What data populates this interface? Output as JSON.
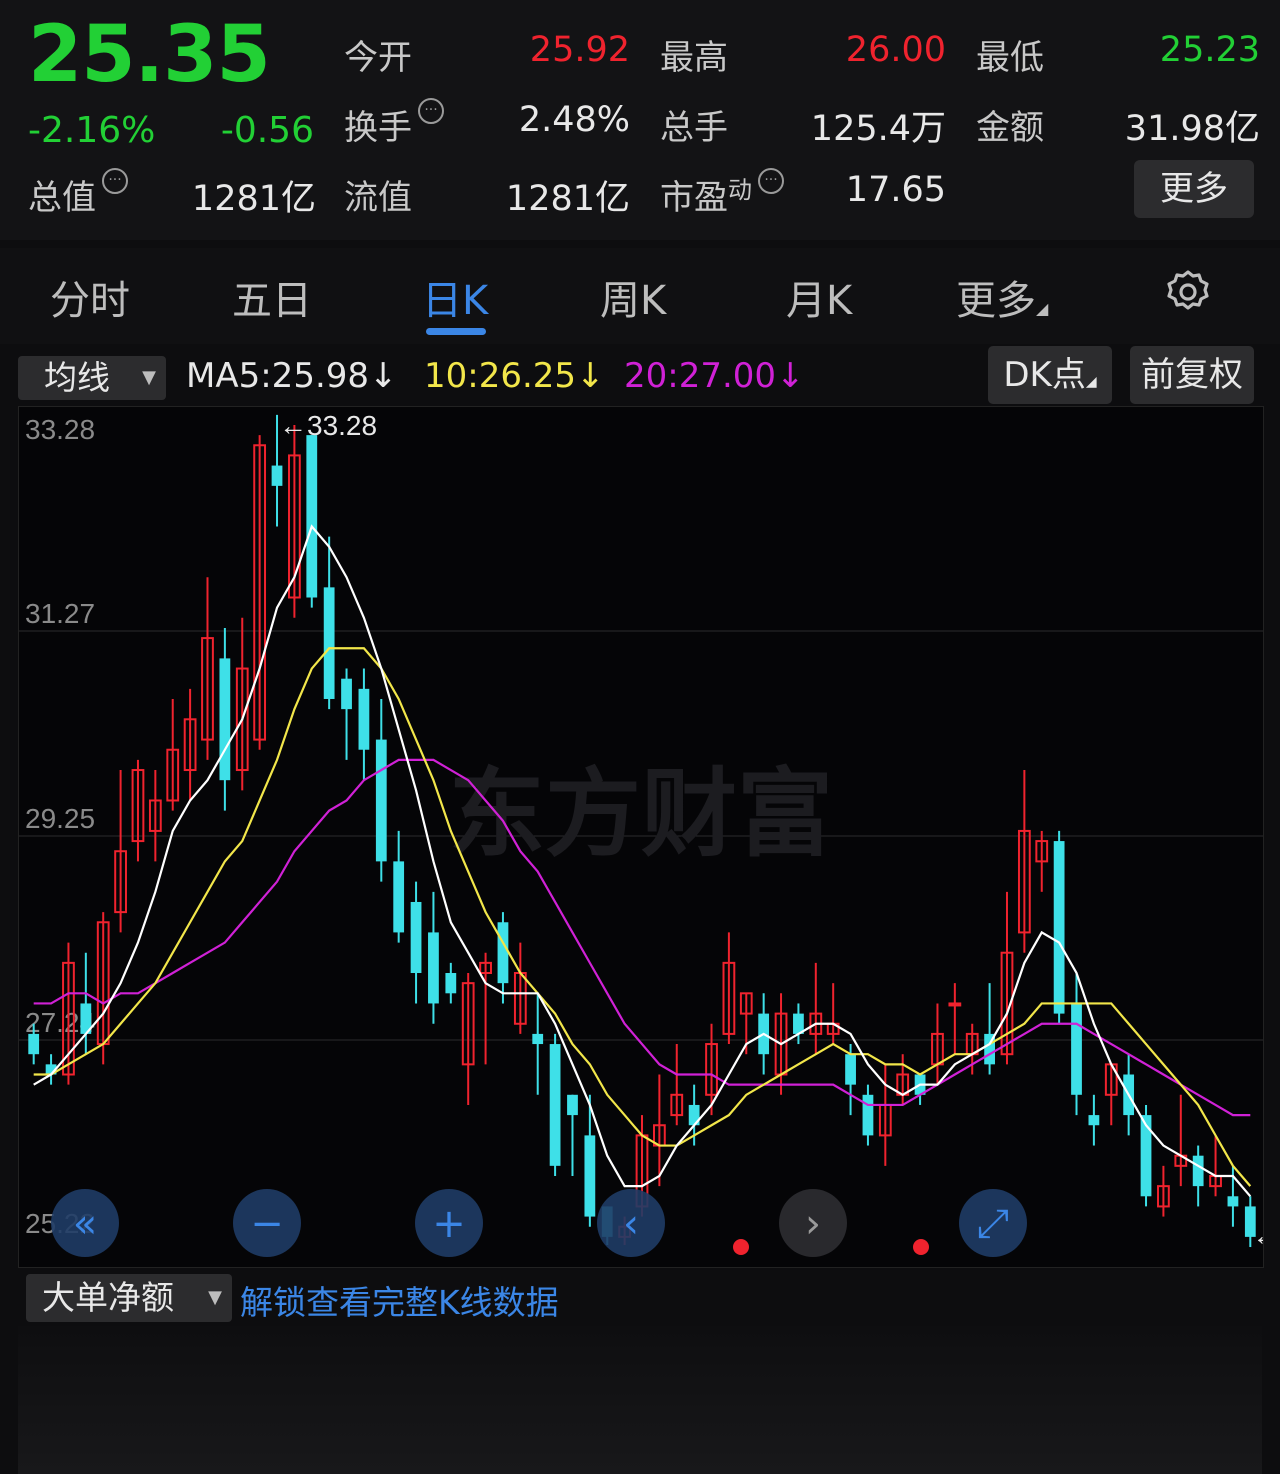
{
  "quote": {
    "price": "25.35",
    "change_pct": "-2.16%",
    "change": "-0.56",
    "fields": [
      {
        "label": "今开",
        "value": "25.92",
        "color": "red"
      },
      {
        "label": "最高",
        "value": "26.00",
        "color": "red"
      },
      {
        "label": "最低",
        "value": "25.23",
        "color": "green"
      },
      {
        "label": "换手",
        "value": "2.48%",
        "color": "white"
      },
      {
        "label": "总手",
        "value": "125.4万",
        "color": "white"
      },
      {
        "label": "金额",
        "value": "31.98亿",
        "color": "white"
      },
      {
        "label": "总值",
        "value": "1281亿",
        "color": "white"
      },
      {
        "label": "流值",
        "value": "1281亿",
        "color": "white"
      },
      {
        "label": "市盈",
        "label_sup": "动",
        "value": "17.65",
        "color": "white"
      }
    ],
    "more_label": "更多"
  },
  "tabs": [
    "分时",
    "五日",
    "日K",
    "周K",
    "月K",
    "更多"
  ],
  "active_tab": 2,
  "ma_bar": {
    "selector": "均线",
    "ma5": "MA5:25.98",
    "ma10": "10:26.25",
    "ma20": "20:27.00",
    "arrow": "↓",
    "dk_label": "DK点",
    "adjust_label": "前复权"
  },
  "bottom": {
    "selector": "大单净额",
    "unlock": "解锁查看完整K线数据"
  },
  "watermark": "东方财富",
  "colors": {
    "up": "#f0232e",
    "down": "#3ee0e8",
    "ma5": "#ffffff",
    "ma10": "#f2e64a",
    "ma20": "#d021d6",
    "accent": "#3b86e6",
    "price_green": "#22d035"
  },
  "chart_data": {
    "type": "candlestick",
    "y_ticks": [
      "33.28",
      "31.27",
      "29.25",
      "27.24",
      "25.22"
    ],
    "ylim": [
      25.22,
      33.28
    ],
    "max_label": "33.28",
    "min_label": "25.22",
    "candles": [
      [
        27.3,
        27.1,
        27.4,
        27.0
      ],
      [
        27.0,
        26.9,
        27.1,
        26.8
      ],
      [
        26.9,
        28.0,
        28.2,
        26.8
      ],
      [
        27.6,
        27.3,
        28.1,
        27.1
      ],
      [
        27.2,
        28.4,
        28.5,
        27.0
      ],
      [
        28.5,
        29.1,
        29.9,
        28.3
      ],
      [
        29.2,
        29.9,
        30.0,
        29.0
      ],
      [
        29.3,
        29.6,
        29.9,
        29.0
      ],
      [
        29.6,
        30.1,
        30.6,
        29.5
      ],
      [
        29.9,
        30.4,
        30.7,
        29.6
      ],
      [
        30.2,
        31.2,
        31.8,
        30.0
      ],
      [
        31.0,
        29.8,
        31.3,
        29.5
      ],
      [
        29.9,
        30.9,
        31.4,
        29.7
      ],
      [
        30.2,
        33.1,
        33.2,
        30.1
      ],
      [
        32.9,
        32.7,
        33.4,
        32.3
      ],
      [
        31.6,
        33.0,
        33.3,
        31.4
      ],
      [
        33.2,
        31.6,
        33.2,
        31.5
      ],
      [
        31.7,
        30.6,
        32.2,
        30.5
      ],
      [
        30.8,
        30.5,
        30.9,
        30.0
      ],
      [
        30.7,
        30.1,
        30.9,
        29.8
      ],
      [
        30.2,
        29.0,
        30.6,
        28.8
      ],
      [
        29.0,
        28.3,
        29.3,
        28.2
      ],
      [
        28.6,
        27.9,
        28.8,
        27.6
      ],
      [
        28.3,
        27.6,
        28.7,
        27.4
      ],
      [
        27.9,
        27.7,
        28.0,
        27.6
      ],
      [
        27.0,
        27.8,
        27.9,
        26.6
      ],
      [
        27.9,
        28.0,
        28.1,
        27.0
      ],
      [
        28.4,
        27.8,
        28.5,
        27.6
      ],
      [
        27.4,
        27.9,
        28.2,
        27.3
      ],
      [
        27.3,
        27.2,
        27.7,
        26.7
      ],
      [
        27.2,
        26.0,
        27.3,
        25.9
      ],
      [
        26.7,
        26.5,
        26.7,
        25.9
      ],
      [
        26.3,
        25.5,
        26.7,
        25.4
      ],
      [
        25.6,
        25.3,
        25.6,
        25.22
      ],
      [
        25.3,
        25.4,
        25.5,
        25.22
      ],
      [
        25.6,
        26.3,
        26.5,
        25.5
      ],
      [
        26.2,
        26.4,
        26.9,
        25.8
      ],
      [
        26.5,
        26.7,
        27.2,
        26.4
      ],
      [
        26.6,
        26.4,
        26.8,
        26.2
      ],
      [
        26.7,
        27.2,
        27.4,
        26.5
      ],
      [
        27.3,
        28.0,
        28.3,
        27.2
      ],
      [
        27.5,
        27.7,
        27.7,
        27.1
      ],
      [
        27.5,
        27.1,
        27.7,
        26.9
      ],
      [
        26.9,
        27.5,
        27.7,
        26.7
      ],
      [
        27.5,
        27.3,
        27.6,
        27.2
      ],
      [
        27.3,
        27.5,
        28.0,
        27.1
      ],
      [
        27.3,
        27.4,
        27.8,
        27.2
      ],
      [
        27.1,
        26.8,
        27.2,
        26.5
      ],
      [
        26.7,
        26.3,
        26.8,
        26.2
      ],
      [
        26.3,
        26.6,
        27.0,
        26.0
      ],
      [
        26.7,
        26.9,
        27.1,
        26.6
      ],
      [
        26.9,
        26.7,
        26.9,
        26.6
      ],
      [
        27.0,
        27.3,
        27.6,
        26.8
      ],
      [
        27.6,
        27.6,
        27.8,
        27.1
      ],
      [
        27.1,
        27.3,
        27.4,
        26.9
      ],
      [
        27.3,
        27.0,
        27.8,
        26.9
      ],
      [
        27.1,
        28.1,
        28.7,
        27.0
      ],
      [
        28.3,
        29.3,
        29.9,
        28.1
      ],
      [
        29.0,
        29.2,
        29.3,
        28.7
      ],
      [
        29.2,
        27.5,
        29.3,
        27.4
      ],
      [
        27.6,
        26.7,
        27.9,
        26.5
      ],
      [
        26.5,
        26.4,
        26.7,
        26.2
      ],
      [
        26.7,
        27.0,
        27.0,
        26.4
      ],
      [
        26.9,
        26.5,
        27.1,
        26.3
      ],
      [
        26.5,
        25.7,
        26.6,
        25.6
      ],
      [
        25.6,
        25.8,
        26.0,
        25.5
      ],
      [
        26.0,
        26.1,
        26.7,
        25.8
      ],
      [
        26.1,
        25.8,
        26.2,
        25.6
      ],
      [
        25.8,
        25.9,
        26.3,
        25.7
      ],
      [
        25.7,
        25.6,
        26.0,
        25.4
      ],
      [
        25.6,
        25.3,
        25.7,
        25.2
      ]
    ],
    "ma5_series": [
      26.8,
      26.9,
      27.1,
      27.3,
      27.5,
      27.8,
      28.2,
      28.7,
      29.3,
      29.6,
      29.8,
      30.1,
      30.4,
      30.9,
      31.5,
      31.8,
      32.3,
      32.1,
      31.8,
      31.4,
      30.9,
      30.3,
      29.7,
      29.0,
      28.4,
      28.1,
      27.8,
      27.7,
      27.7,
      27.7,
      27.4,
      27.0,
      26.6,
      26.1,
      25.8,
      25.8,
      25.9,
      26.2,
      26.4,
      26.6,
      26.9,
      27.2,
      27.3,
      27.2,
      27.3,
      27.4,
      27.4,
      27.3,
      27.0,
      26.8,
      26.7,
      26.8,
      26.8,
      27.0,
      27.1,
      27.2,
      27.5,
      28.0,
      28.3,
      28.2,
      27.9,
      27.4,
      27.0,
      26.7,
      26.4,
      26.2,
      26.1,
      26.0,
      25.9,
      25.9,
      25.7
    ],
    "ma10_series": [
      26.9,
      26.9,
      27.0,
      27.1,
      27.2,
      27.4,
      27.6,
      27.8,
      28.1,
      28.4,
      28.7,
      29.0,
      29.2,
      29.6,
      30.0,
      30.5,
      30.9,
      31.1,
      31.1,
      31.1,
      30.9,
      30.6,
      30.2,
      29.8,
      29.3,
      28.9,
      28.5,
      28.2,
      27.9,
      27.7,
      27.5,
      27.2,
      27.0,
      26.7,
      26.5,
      26.3,
      26.2,
      26.2,
      26.3,
      26.4,
      26.5,
      26.7,
      26.8,
      26.9,
      27.0,
      27.1,
      27.2,
      27.1,
      27.1,
      27.0,
      27.0,
      26.9,
      27.0,
      27.1,
      27.1,
      27.2,
      27.3,
      27.4,
      27.6,
      27.6,
      27.6,
      27.6,
      27.6,
      27.4,
      27.2,
      27.0,
      26.8,
      26.6,
      26.3,
      26.0,
      25.8
    ],
    "ma20_series": [
      27.6,
      27.6,
      27.7,
      27.7,
      27.6,
      27.7,
      27.7,
      27.8,
      27.9,
      28.0,
      28.1,
      28.2,
      28.4,
      28.6,
      28.8,
      29.1,
      29.3,
      29.5,
      29.6,
      29.8,
      29.9,
      30.0,
      30.0,
      30.0,
      29.9,
      29.8,
      29.6,
      29.4,
      29.1,
      28.9,
      28.6,
      28.3,
      28.0,
      27.7,
      27.4,
      27.2,
      27.0,
      26.9,
      26.9,
      26.9,
      26.8,
      26.8,
      26.8,
      26.8,
      26.8,
      26.8,
      26.8,
      26.7,
      26.6,
      26.6,
      26.6,
      26.7,
      26.8,
      26.9,
      27.0,
      27.1,
      27.2,
      27.3,
      27.4,
      27.4,
      27.4,
      27.3,
      27.2,
      27.1,
      27.0,
      26.9,
      26.8,
      26.7,
      26.6,
      26.5,
      26.5
    ]
  }
}
